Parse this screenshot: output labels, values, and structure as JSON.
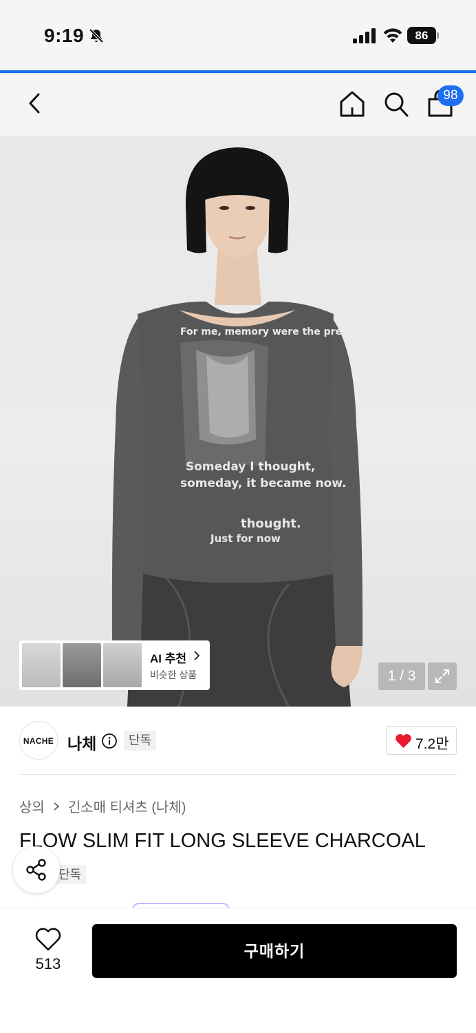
{
  "status_bar": {
    "time": "9:19",
    "battery": "86"
  },
  "nav": {
    "cart_count": "98"
  },
  "hero": {
    "print_lines": [
      "For me, memory were the present and",
      "Someday I thought,",
      "someday, it became now.",
      "thought.",
      "Just for now"
    ],
    "ai_card": {
      "title": "AI 추천",
      "subtitle": "비슷한 상품"
    },
    "pager": "1 / 3"
  },
  "brand": {
    "logo_text": "NACHE",
    "name": "나체",
    "tag": "단독",
    "likes": "7.2만"
  },
  "product": {
    "breadcrumb": [
      "상의",
      "긴소매 티셔츠 (나체)"
    ],
    "title": "FLOW SLIM FIT LONG SLEEVE CHARCOAL",
    "tag": "단독"
  },
  "bottom_bar": {
    "wish_count": "513",
    "buy_label": "구매하기"
  },
  "colors": {
    "accent_blue": "#1f6ff0",
    "like_red": "#e8192c",
    "buy_black": "#000000"
  },
  "icons": [
    "bell-slash-icon",
    "signal-icon",
    "wifi-icon",
    "back-icon",
    "home-icon",
    "search-icon",
    "bag-icon",
    "chevron-right-icon",
    "expand-icon",
    "info-icon",
    "heart-filled-icon",
    "share-icon",
    "heart-outline-icon"
  ]
}
